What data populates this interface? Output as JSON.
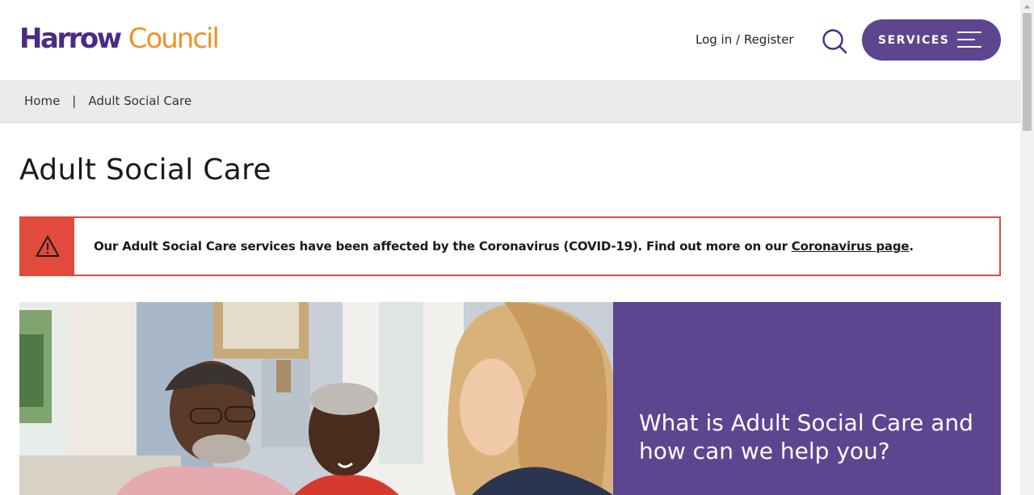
{
  "header": {
    "logo": {
      "part1": "Harrow",
      "part2": "Council"
    },
    "login_label": "Log in / Register",
    "search_icon": "search-icon",
    "services_label": "SERVICES",
    "menu_icon": "hamburger-menu-icon"
  },
  "breadcrumb": {
    "items": [
      "Home",
      "Adult Social Care"
    ],
    "separator": "|"
  },
  "main": {
    "title": "Adult Social Care",
    "alert": {
      "icon": "warning-triangle-icon",
      "text_before": "Our Adult Social Care services have been affected by the Coronavirus (COVID-19). Find out more on our ",
      "link_text": "Coronavirus page",
      "text_after": "."
    },
    "hero": {
      "heading": "What is Adult Social Care and how can we help you?"
    }
  },
  "colors": {
    "brand_purple": "#4b2a85",
    "panel_purple": "#5e4590",
    "brand_orange": "#f0912a",
    "alert_red": "#e04b3c",
    "breadcrumb_bg": "#ebebeb"
  }
}
